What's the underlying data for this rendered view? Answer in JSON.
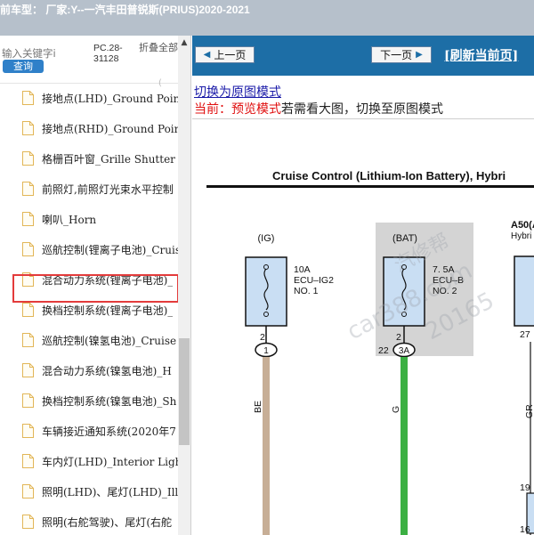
{
  "window": {
    "title": "前车型：  厂家:Y--一汽丰田普锐斯(PRIUS)2020-2021"
  },
  "sidebar": {
    "search_placeholder": "输入关键字i",
    "search_button": "查询",
    "pc_code": "PC.28-31128",
    "collapse_all": "折叠全部",
    "partial_top": "(",
    "items": [
      {
        "label": "接地点(LHD)_Ground Point"
      },
      {
        "label": "接地点(RHD)_Ground Point"
      },
      {
        "label": "格栅百叶窗_Grille Shutter"
      },
      {
        "label": "前照灯,前照灯光束水平控制"
      },
      {
        "label": "喇叭_Horn"
      },
      {
        "label": "巡航控制(锂离子电池)_Cruise"
      },
      {
        "label": "混合动力系统(锂离子电池)_"
      },
      {
        "label": "换档控制系统(锂离子电池)_"
      },
      {
        "label": "巡航控制(镍氢电池)_Cruise"
      },
      {
        "label": "混合动力系统(镍氢电池)_H"
      },
      {
        "label": "换档控制系统(镍氢电池)_Sh"
      },
      {
        "label": "车辆接近通知系统(2020年7"
      },
      {
        "label": "车内灯(LHD)_Interior Light"
      },
      {
        "label": "照明(LHD)、尾灯(LHD)_Illu"
      },
      {
        "label": "照明(右舵驾驶)、尾灯(右舵"
      }
    ],
    "selected_index": 6
  },
  "toolbar": {
    "prev_label": "上一页",
    "next_label": "下一页",
    "refresh_label": "[刷新当前页]"
  },
  "view": {
    "switch_link": "切换为原图模式",
    "status_prefix": "当前：预览模式",
    "status_rest": "若需看大图，切换至原图模式"
  },
  "diagram": {
    "title": "Cruise Control (Lithium-Ion Battery), Hybri",
    "fuse1": {
      "header": "(IG)",
      "rating": "10A",
      "name1": "ECU–IG2",
      "name2": "NO. 1",
      "pin": "2",
      "conn": "1",
      "wire": "BE"
    },
    "fuse2": {
      "header": "(BAT)",
      "rating": "7. 5A",
      "name1": "ECU–B",
      "name2": "NO. 2",
      "pin": "2",
      "conn_pin": "22",
      "conn": "3A",
      "wire": "G"
    },
    "right": {
      "header": "A50(A",
      "sub": "Hybri",
      "pin": "27",
      "wire": "GR",
      "pin2": "19",
      "pin3": "16"
    },
    "watermark1": "汽修帮",
    "watermark2": "car388.com",
    "watermark3": "20165",
    "colors": {
      "wire_be": "#c7ae96",
      "wire_g": "#3cb043",
      "fuse_fill": "#c9def3",
      "watermark": "#9aa0a8"
    }
  }
}
